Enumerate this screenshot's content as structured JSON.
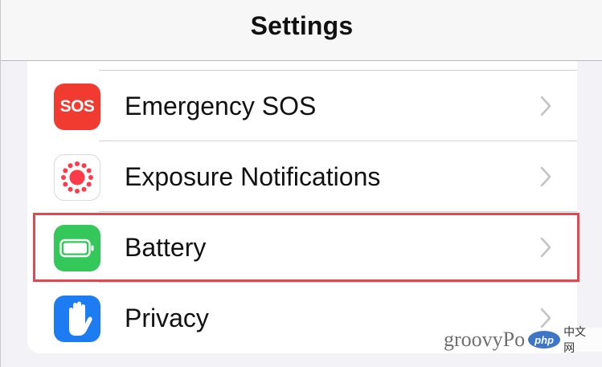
{
  "header": {
    "title": "Settings"
  },
  "rows": [
    {
      "label": "Emergency SOS",
      "icon": "sos-icon",
      "icon_text": "SOS",
      "icon_color": "#f23b30"
    },
    {
      "label": "Exposure Notifications",
      "icon": "exposure-notifications-icon",
      "icon_color": "#ff3b4a"
    },
    {
      "label": "Battery",
      "icon": "battery-icon",
      "icon_color": "#34c759",
      "highlighted": true
    },
    {
      "label": "Privacy",
      "icon": "hand-icon",
      "icon_color": "#1e7cf2"
    }
  ],
  "colors": {
    "highlight_border": "#e0494f",
    "chevron": "#c4c4c7",
    "background": "#f2f2f7"
  },
  "watermark": {
    "text": "groovyPo",
    "badge": "php",
    "suffix": "中文网"
  }
}
